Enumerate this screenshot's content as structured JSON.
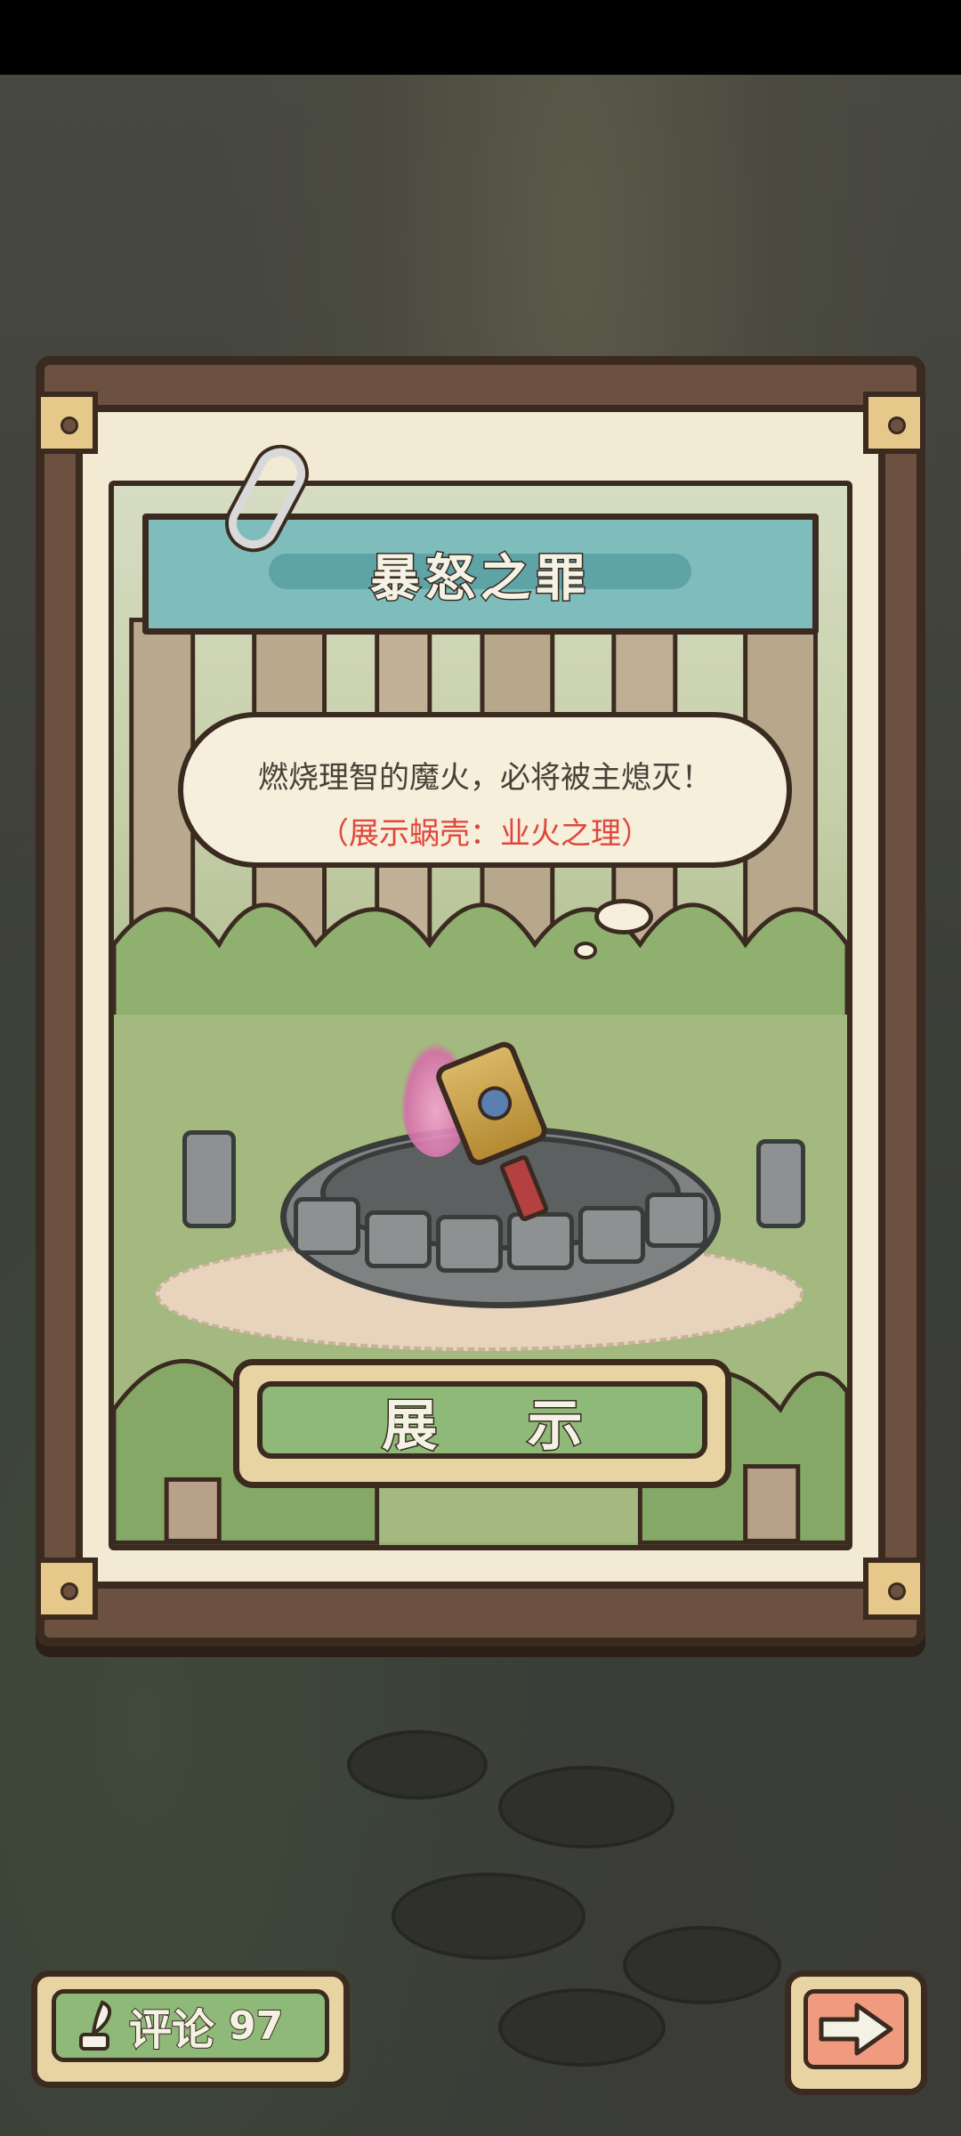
{
  "card": {
    "title": "暴怒之罪",
    "dialogue_line1": "燃烧理智的魔火，必将被主熄灭！",
    "dialogue_line2": "（展示蜗壳：业火之理）"
  },
  "actions": {
    "show_label": "展 示"
  },
  "bottom_bar": {
    "comment_label": "评论",
    "comment_count": "97"
  },
  "icons": {
    "paperclip": "paperclip-icon",
    "quill": "quill-icon",
    "next_arrow": "arrow-right-icon",
    "item": "prayer-wheel-item"
  },
  "colors": {
    "title_banner": "#7fbdbd",
    "button_green": "#8fb978",
    "button_frame": "#e8d3a2",
    "next_button": "#f09a80",
    "highlight_text": "#e0473c",
    "outline": "#3a2a20"
  }
}
